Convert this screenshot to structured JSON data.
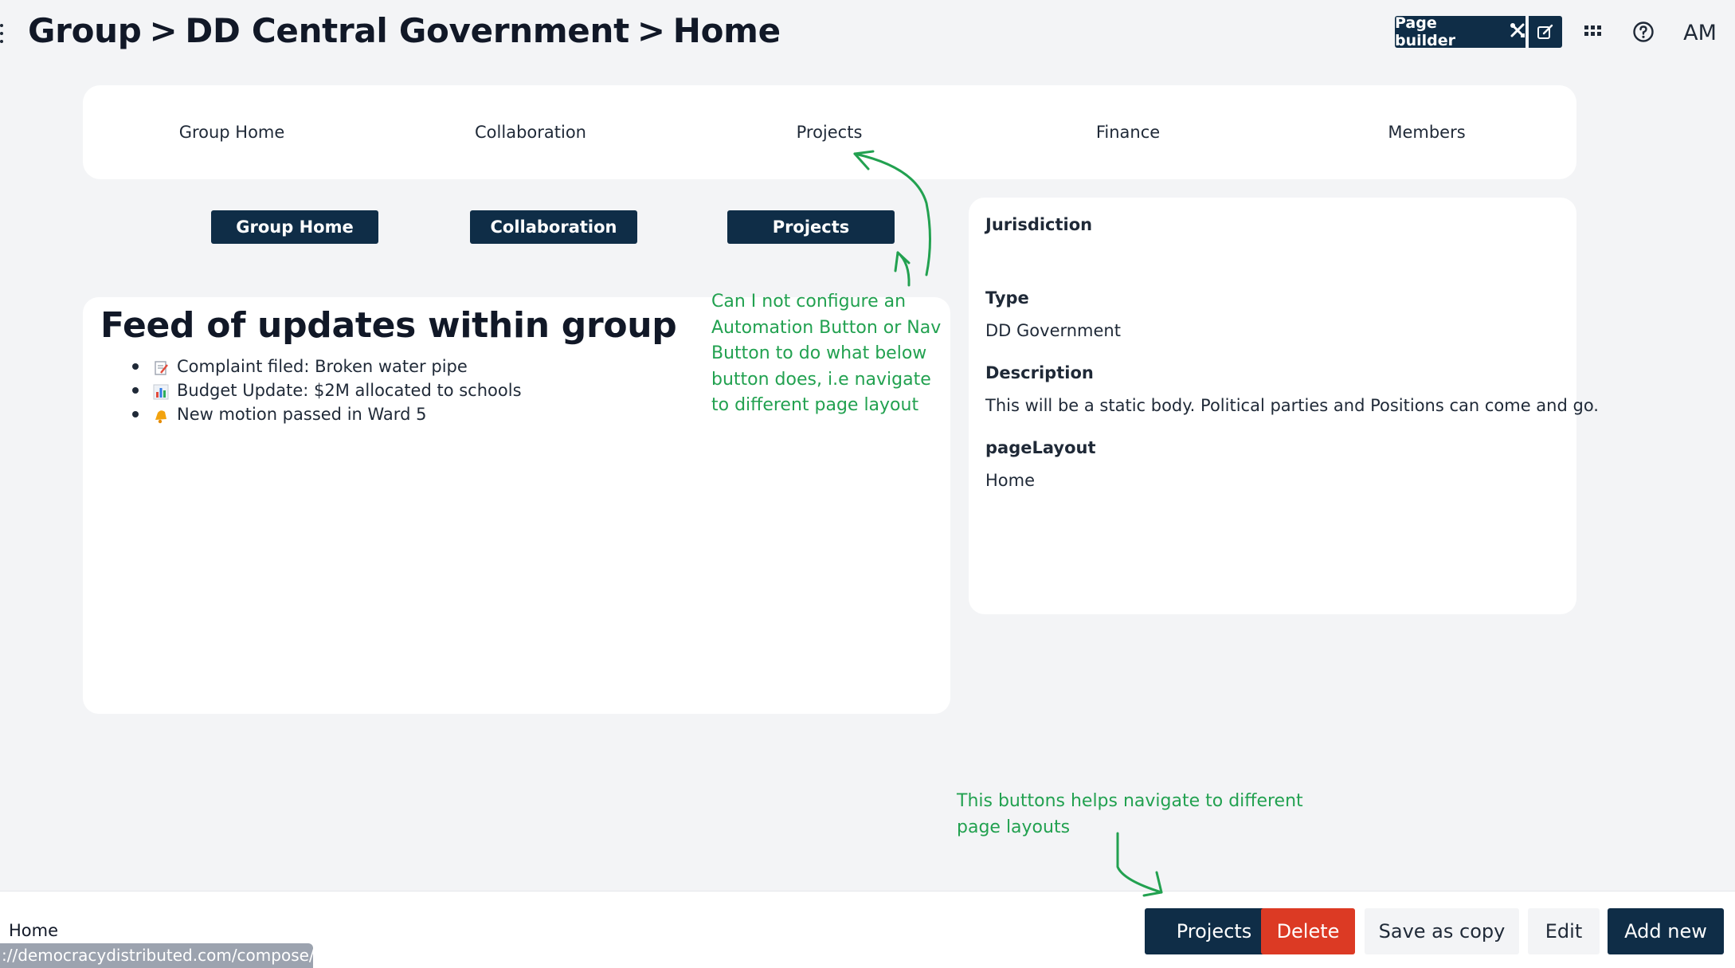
{
  "header": {
    "breadcrumb": [
      "Group",
      "DD Central Government",
      "Home"
    ],
    "separator": ">",
    "page_builder_label": "Page builder",
    "avatar_initials": "AM"
  },
  "nav_tabs": [
    "Group Home",
    "Collaboration",
    "Projects",
    "Finance",
    "Members"
  ],
  "nav_buttons": [
    "Group Home",
    "Collaboration",
    "Projects"
  ],
  "feed": {
    "title": "Feed of updates within group",
    "items": [
      {
        "icon": "memo-icon",
        "text": "Complaint filed: Broken water pipe"
      },
      {
        "icon": "bar-chart-icon",
        "text": "Budget Update: $2M allocated to schools"
      },
      {
        "icon": "bell-icon",
        "text": "New motion passed in Ward 5"
      }
    ]
  },
  "details": {
    "jurisdiction_label": "Jurisdiction",
    "jurisdiction_value": "",
    "type_label": "Type",
    "type_value": "DD Government",
    "description_label": "Description",
    "description_value": "This will be a static body. Political parties and Positions can come and go.",
    "page_layout_label": "pageLayout",
    "page_layout_value": "Home"
  },
  "annotations": {
    "top_note": [
      "Can I not configure an",
      "Automation Button or Nav",
      "Button to do what below",
      "button does, i.e navigate",
      "to different page layout"
    ],
    "bottom_note": [
      "This buttons helps navigate to different",
      "page layouts"
    ]
  },
  "footer": {
    "current_layout": "Home",
    "status_url": "://democracydistributed.com/compose/#",
    "actions": {
      "projects": "Projects",
      "delete": "Delete",
      "save_copy": "Save as copy",
      "edit": "Edit",
      "add_new": "Add new"
    }
  },
  "colors": {
    "primary": "#0f2d47",
    "danger": "#dc3a24",
    "annotation": "#22a150",
    "background": "#f3f4f6"
  }
}
